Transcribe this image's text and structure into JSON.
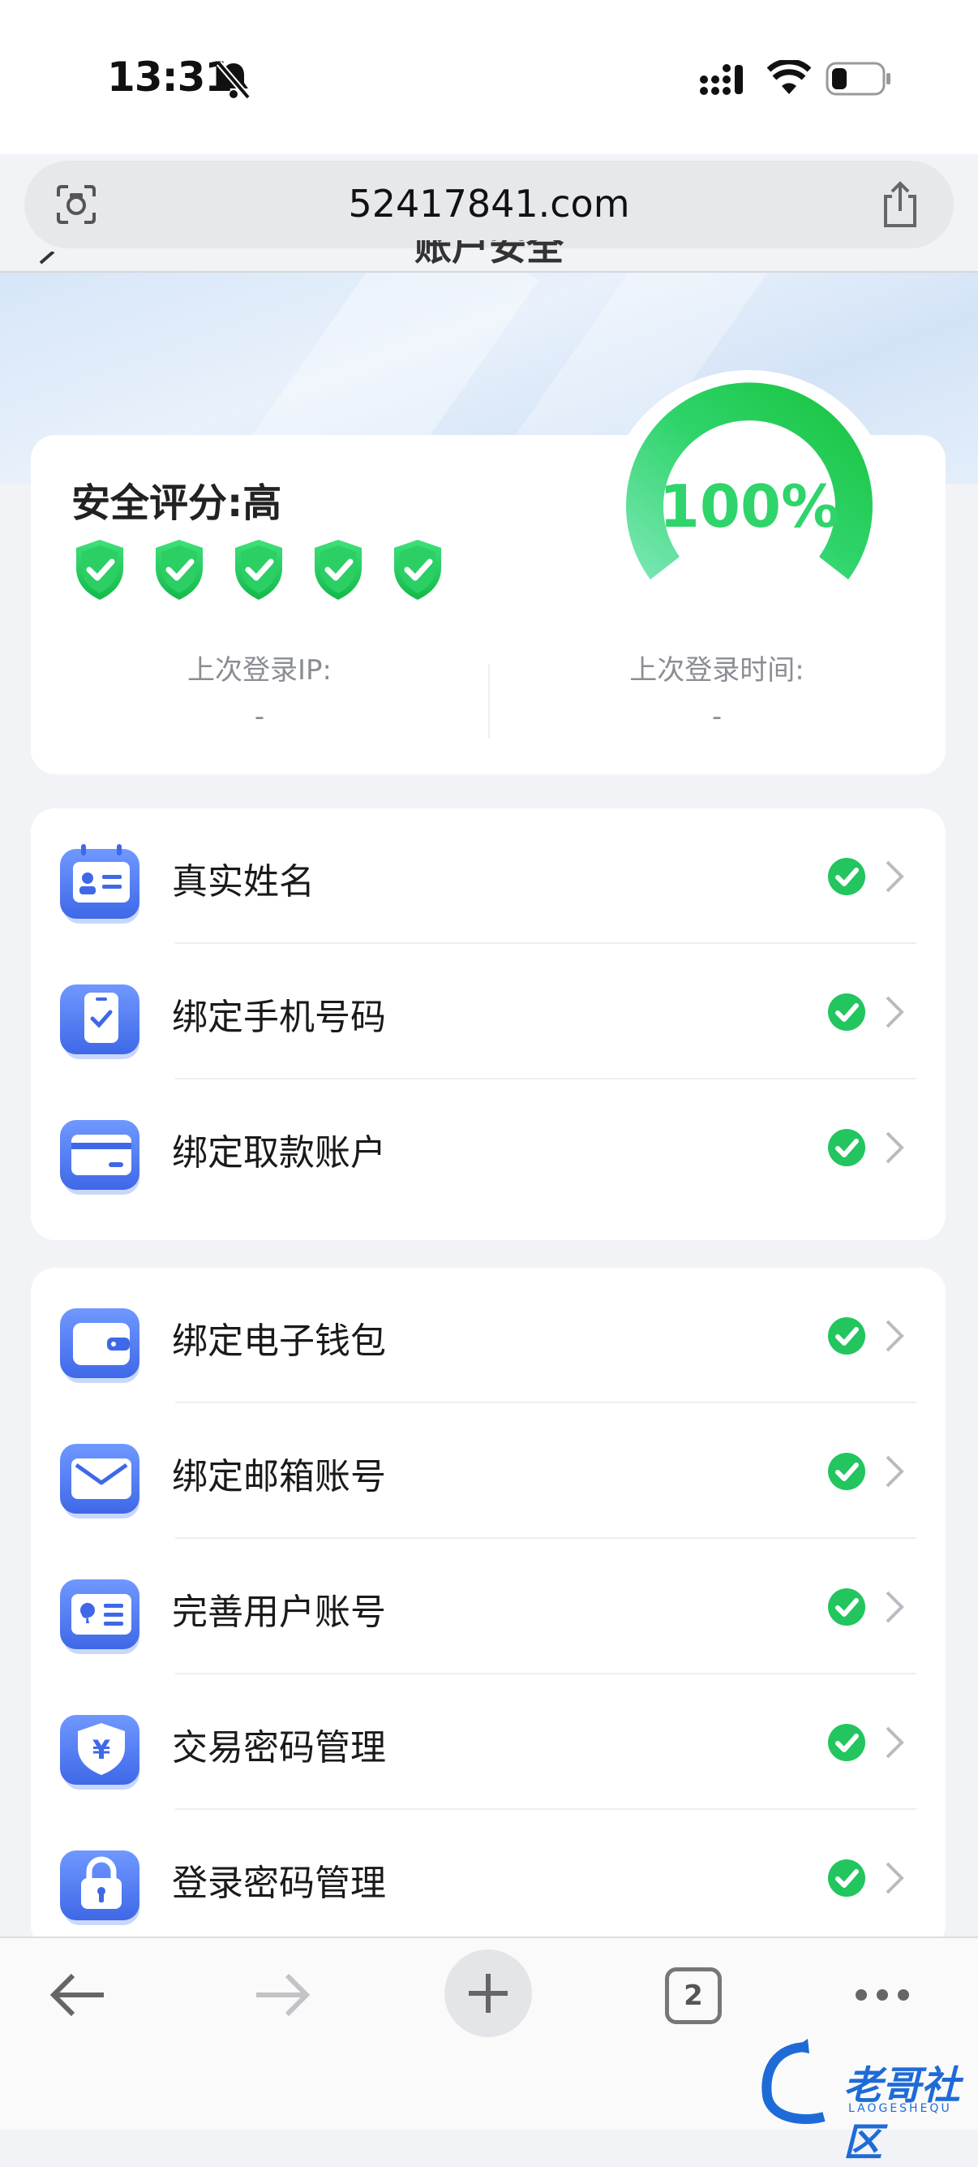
{
  "status": {
    "time": "13:31"
  },
  "browser": {
    "url": "52417841.com",
    "tab_count": "2"
  },
  "page": {
    "title": "账户安全"
  },
  "score": {
    "label": "安全评分:高",
    "percent": "100%",
    "stars": 5,
    "last_ip_label": "上次登录IP:",
    "last_ip_value": "-",
    "last_time_label": "上次登录时间:",
    "last_time_value": "-"
  },
  "group1": [
    {
      "label": "真实姓名",
      "icon": "id-card-icon",
      "verified": true
    },
    {
      "label": "绑定手机号码",
      "icon": "phone-icon",
      "verified": true
    },
    {
      "label": "绑定取款账户",
      "icon": "bank-card-icon",
      "verified": true
    }
  ],
  "group2": [
    {
      "label": "绑定电子钱包",
      "icon": "wallet-icon",
      "verified": true
    },
    {
      "label": "绑定邮箱账号",
      "icon": "mail-icon",
      "verified": true
    },
    {
      "label": "完善用户账号",
      "icon": "user-card-icon",
      "verified": true
    },
    {
      "label": "交易密码管理",
      "icon": "yuan-shield-icon",
      "verified": true
    },
    {
      "label": "登录密码管理",
      "icon": "lock-icon",
      "verified": true
    }
  ],
  "watermark": {
    "text": "老哥社区",
    "sub": "LAOGESHEQU"
  },
  "colors": {
    "accent_green": "#22c55e",
    "icon_blue": "#4f7cf0",
    "gauge_green": "#19c24a"
  }
}
